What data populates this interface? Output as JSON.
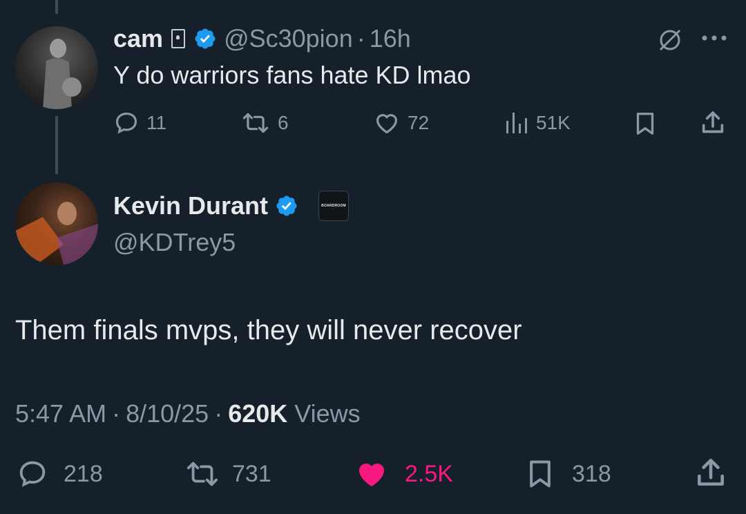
{
  "reply_to": {
    "name": "cam",
    "handle": "@Sc30pion",
    "sep": "·",
    "time": "16h",
    "text": "Y do warriors fans hate KD lmao",
    "counts": {
      "replies": "11",
      "reposts": "6",
      "likes": "72",
      "views": "51K"
    }
  },
  "tweet": {
    "name": "Kevin Durant",
    "handle": "@KDTrey5",
    "affiliate": "BOARDROOM",
    "text": "Them finals mvps, they will never recover",
    "time": "5:47 AM",
    "sep1": "·",
    "date": "8/10/25",
    "sep2": "·",
    "views_count": "620K",
    "views_label": "Views",
    "counts": {
      "replies": "218",
      "reposts": "731",
      "likes": "2.5K",
      "bookmarks": "318"
    }
  },
  "colors": {
    "background": "#15202b",
    "verified": "#1d9bf0",
    "liked": "#f91880",
    "muted": "#8b98a5"
  }
}
